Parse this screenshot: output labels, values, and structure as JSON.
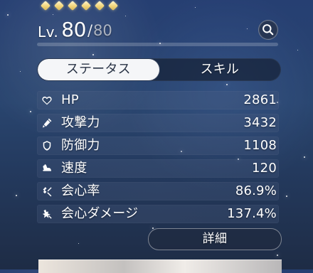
{
  "header": {
    "diamond_count": 6,
    "level_label": "Lv.",
    "level_current": "80",
    "level_separator": "/",
    "level_max": "80",
    "exp_progress": 0
  },
  "tabs": [
    {
      "label": "ステータス",
      "active": true
    },
    {
      "label": "スキル",
      "active": false
    }
  ],
  "stats": [
    {
      "icon": "heart-icon",
      "label": "HP",
      "value": "2861"
    },
    {
      "icon": "sword-icon",
      "label": "攻撃力",
      "value": "3432"
    },
    {
      "icon": "shield-icon",
      "label": "防御力",
      "value": "1108"
    },
    {
      "icon": "boot-icon",
      "label": "速度",
      "value": "120"
    },
    {
      "icon": "critical-rate-icon",
      "label": "会心率",
      "value": "86.9%"
    },
    {
      "icon": "critical-damage-icon",
      "label": "会心ダメージ",
      "value": "137.4%"
    }
  ],
  "actions": {
    "detail_label": "詳細"
  },
  "colors": {
    "accent_gold": "#f2d579",
    "tab_active_bg": "#f5f6f8",
    "tab_active_text": "#2a3446",
    "panel_text": "#ffffff"
  }
}
